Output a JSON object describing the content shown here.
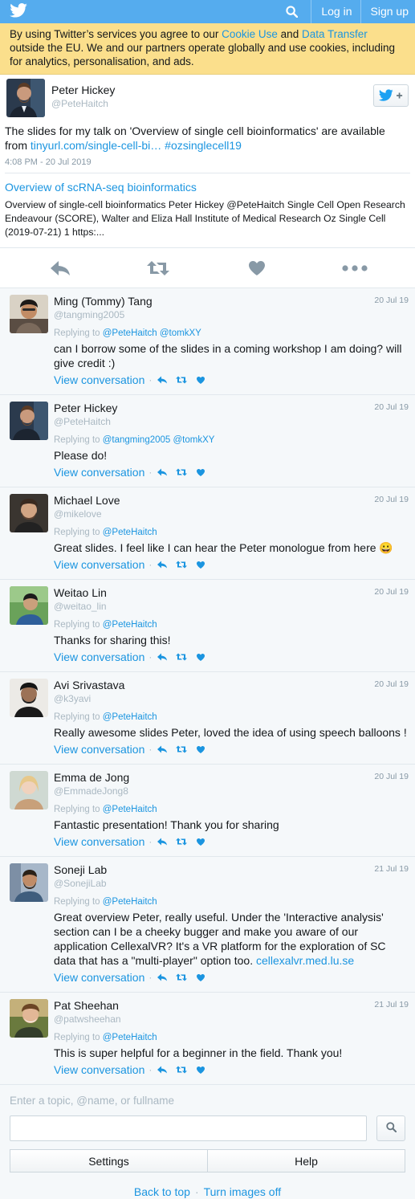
{
  "topbar": {
    "login": "Log in",
    "signup": "Sign up"
  },
  "cookie": {
    "pre": "By using Twitter’s services you agree to our ",
    "link1": "Cookie Use",
    "mid": " and ",
    "link2": "Data Transfer",
    "post": " outside the EU. We and our partners operate globally and use cookies, including for analytics, personalisation, and ads."
  },
  "main_tweet": {
    "name": "Peter Hickey",
    "handle": "@PeteHaitch",
    "text_pre": "The slides for my talk on 'Overview of single cell bioinformatics' are available from ",
    "url": "tinyurl.com/single-cell-bi…",
    "hashtag": "#ozsinglecell19",
    "time": "4:08 PM - 20 Jul 2019",
    "card_title": "Overview of scRNA-seq bioinformatics",
    "card_desc": "Overview of single-cell bioinformatics Peter Hickey @PeteHaitch Single Cell Open Research Endeavour (SCORE), Walter and Eliza Hall Institute of Medical Research Oz Single Cell (2019-07-21) 1 https:..."
  },
  "replies": [
    {
      "name": "Ming (Tommy) Tang",
      "handle": "@tangming2005",
      "date": "20 Jul 19",
      "replying_prefix": "Replying to ",
      "replying_to": "@PeteHaitch @tomkXY",
      "text": "can I borrow some of the slides in a coming workshop I am doing? will give credit :)",
      "link": ""
    },
    {
      "name": "Peter Hickey",
      "handle": "@PeteHaitch",
      "date": "20 Jul 19",
      "replying_prefix": "Replying to ",
      "replying_to": "@tangming2005 @tomkXY",
      "text": "Please do!",
      "link": ""
    },
    {
      "name": "Michael Love",
      "handle": "@mikelove",
      "date": "20 Jul 19",
      "replying_prefix": "Replying to ",
      "replying_to": "@PeteHaitch",
      "text": "Great slides. I feel like I can hear the Peter monologue from here 😀",
      "link": ""
    },
    {
      "name": "Weitao Lin",
      "handle": "@weitao_lin",
      "date": "20 Jul 19",
      "replying_prefix": "Replying to ",
      "replying_to": "@PeteHaitch",
      "text": "Thanks for sharing this!",
      "link": ""
    },
    {
      "name": "Avi Srivastava",
      "handle": "@k3yavi",
      "date": "20 Jul 19",
      "replying_prefix": "Replying to ",
      "replying_to": "@PeteHaitch",
      "text": "Really awesome slides Peter, loved the idea of using speech balloons !",
      "link": ""
    },
    {
      "name": "Emma de Jong",
      "handle": "@EmmadeJong8",
      "date": "20 Jul 19",
      "replying_prefix": "Replying to ",
      "replying_to": "@PeteHaitch",
      "text": "Fantastic presentation! Thank you for sharing",
      "link": ""
    },
    {
      "name": "Soneji Lab",
      "handle": "@SonejiLab",
      "date": "21 Jul 19",
      "replying_prefix": "Replying to ",
      "replying_to": "@PeteHaitch",
      "text": "Great overview Peter, really useful. Under the 'Interactive analysis' section can I be a cheeky bugger and make you aware of our application CellexalVR? It's a VR platform for the exploration of SC data that has a \"multi-player\" option too. ",
      "link": "cellexalvr.med.lu.se"
    },
    {
      "name": "Pat Sheehan",
      "handle": "@patwsheehan",
      "date": "21 Jul 19",
      "replying_prefix": "Replying to ",
      "replying_to": "@PeteHaitch",
      "text": "This is super helpful for a beginner in the field. Thank you!",
      "link": ""
    }
  ],
  "view_conversation": "View conversation",
  "footer": {
    "search_label": "Enter a topic, @name, or fullname",
    "settings": "Settings",
    "help": "Help",
    "back_to_top": "Back to top",
    "turn_images_off": "Turn images off",
    "separator": "·"
  },
  "colors": {
    "brand": "#55acee",
    "link": "#1b95e0",
    "banner": "#fbdf8c"
  }
}
